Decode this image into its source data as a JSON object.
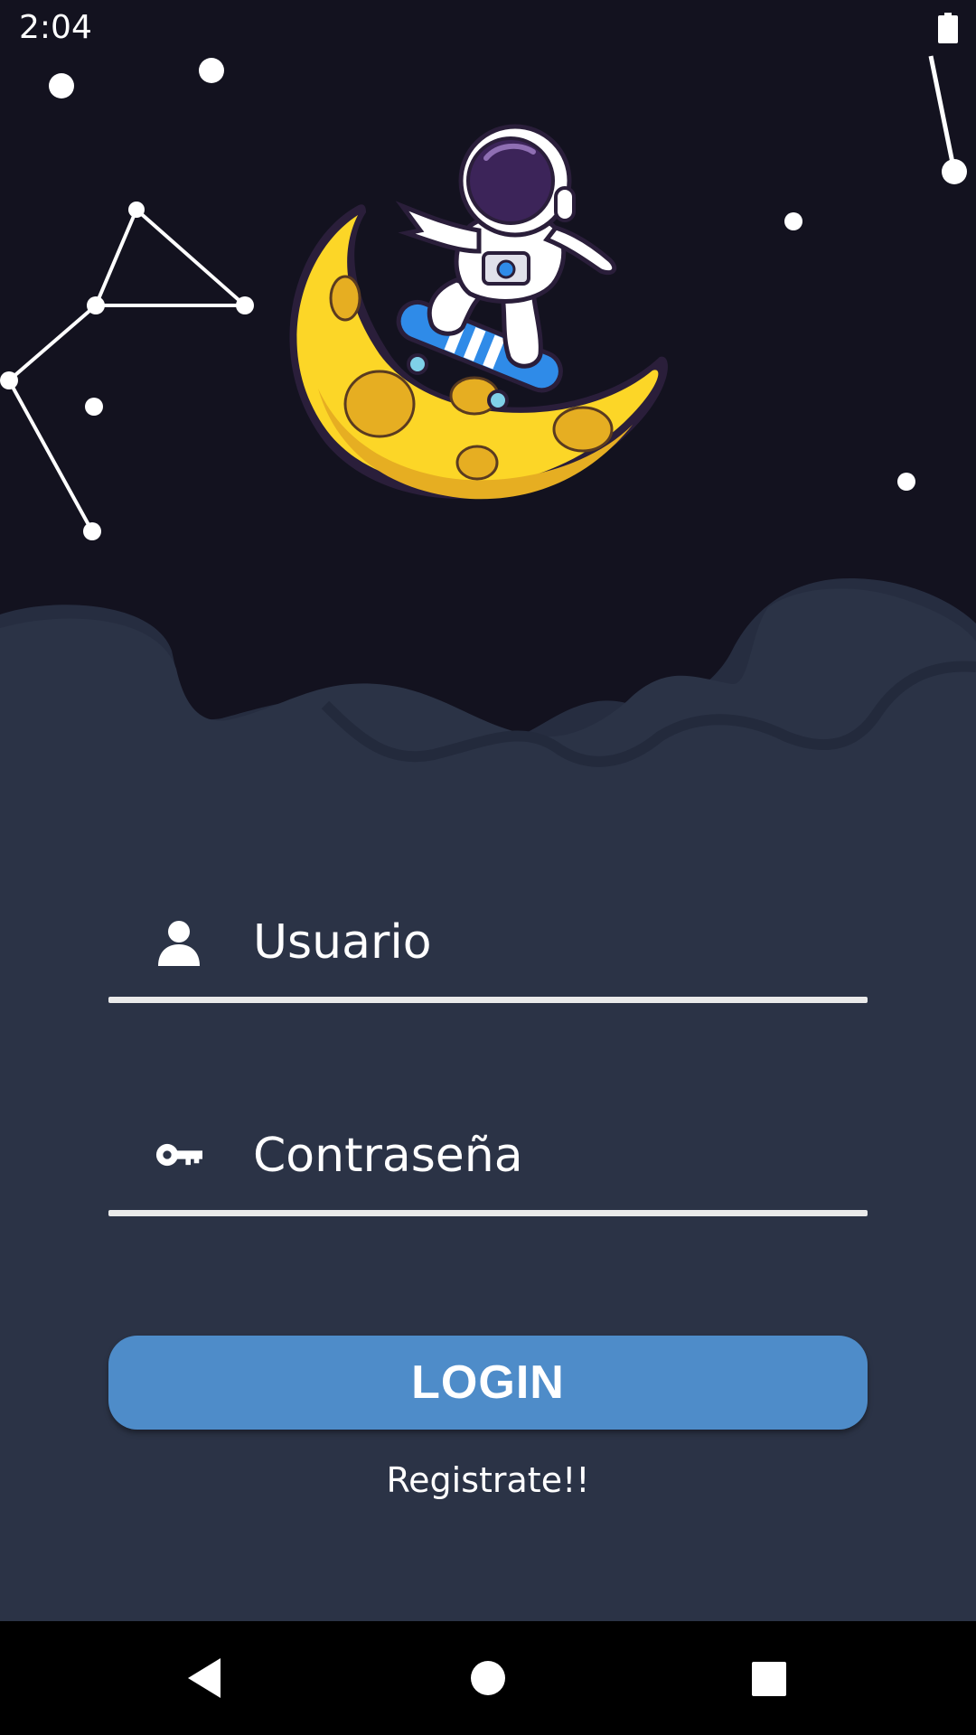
{
  "status_bar": {
    "time": "2:04",
    "battery_icon": "battery-full-icon"
  },
  "colors": {
    "sky": "#13121f",
    "ground": "#2b3346",
    "accent": "#4e8cc9",
    "moon": "#fcd627",
    "text": "#ffffff"
  },
  "login_form": {
    "username_placeholder": "Usuario",
    "username_icon": "person-icon",
    "password_placeholder": "Contraseña",
    "password_icon": "key-icon",
    "login_label": "LOGIN",
    "register_label": "Registrate!!"
  },
  "nav_bar": {
    "back_icon": "back-triangle-icon",
    "home_icon": "home-circle-icon",
    "recents_icon": "recents-square-icon"
  }
}
